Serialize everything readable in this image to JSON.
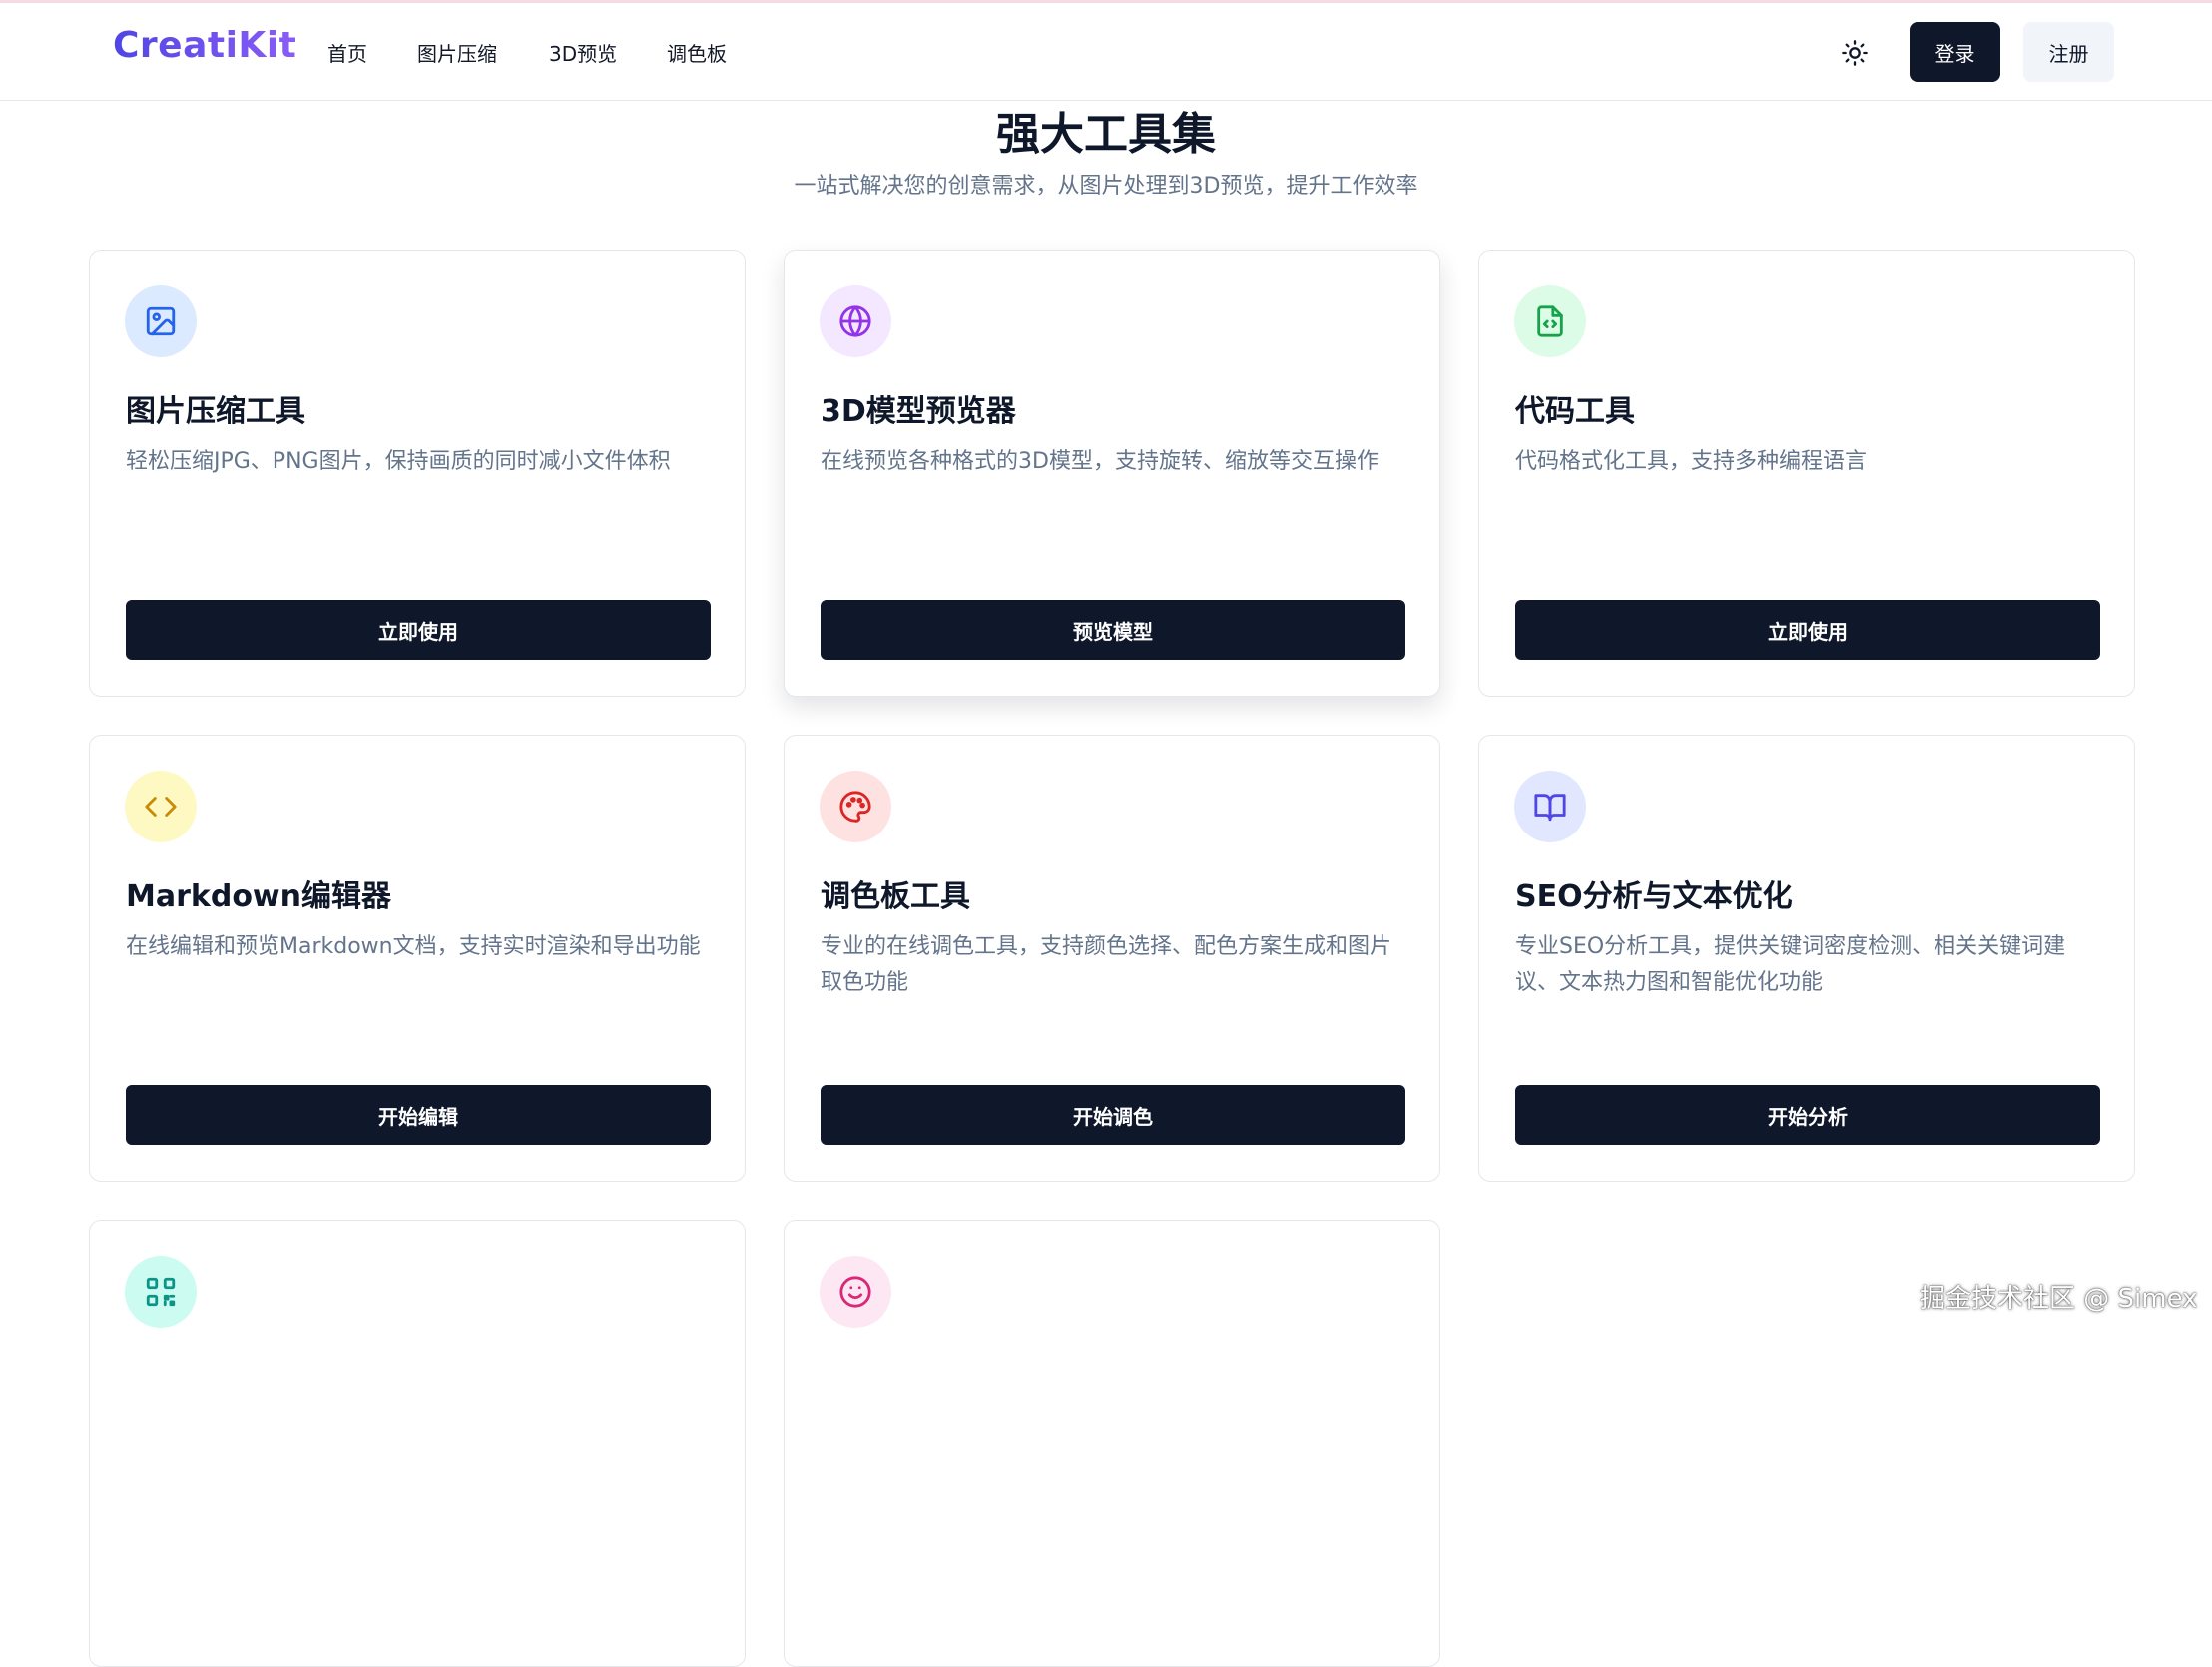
{
  "header": {
    "logo": "CreatiKit",
    "nav": [
      "首页",
      "图片压缩",
      "3D预览",
      "调色板"
    ],
    "theme_icon": "sun-icon",
    "login": "登录",
    "register": "注册"
  },
  "section": {
    "title": "强大工具集",
    "subtitle": "一站式解决您的创意需求，从图片处理到3D预览，提升工作效率"
  },
  "cards": [
    {
      "icon": "image-icon",
      "title": "图片压缩工具",
      "desc": "轻松压缩JPG、PNG图片，保持画质的同时减小文件体积",
      "button": "立即使用",
      "icon_bg": "#dbeafe",
      "icon_color": "#2563eb"
    },
    {
      "icon": "globe-icon",
      "title": "3D模型预览器",
      "desc": "在线预览各种格式的3D模型，支持旋转、缩放等交互操作",
      "button": "预览模型",
      "icon_bg": "#f3e8ff",
      "icon_color": "#9333ea"
    },
    {
      "icon": "code-file-icon",
      "title": "代码工具",
      "desc": "代码格式化工具，支持多种编程语言",
      "button": "立即使用",
      "icon_bg": "#dcfce7",
      "icon_color": "#16a34a"
    },
    {
      "icon": "code-brackets-icon",
      "title": "Markdown编辑器",
      "desc": "在线编辑和预览Markdown文档，支持实时渲染和导出功能",
      "button": "开始编辑",
      "icon_bg": "#fef9c3",
      "icon_color": "#ca8a04"
    },
    {
      "icon": "palette-icon",
      "title": "调色板工具",
      "desc": "专业的在线调色工具，支持颜色选择、配色方案生成和图片取色功能",
      "button": "开始调色",
      "icon_bg": "#fee2e2",
      "icon_color": "#dc2626"
    },
    {
      "icon": "book-icon",
      "title": "SEO分析与文本优化",
      "desc": "专业SEO分析工具，提供关键词密度检测、相关关键词建议、文本热力图和智能优化功能",
      "button": "开始分析",
      "icon_bg": "#e0e7ff",
      "icon_color": "#4f46e5"
    },
    {
      "icon": "qr-code-icon",
      "icon_bg": "#ccfbf1",
      "icon_color": "#0d9488"
    },
    {
      "icon": "smile-icon",
      "icon_bg": "#fce7f3",
      "icon_color": "#db2777"
    }
  ],
  "watermark": "掘金技术社区 @ Simex"
}
